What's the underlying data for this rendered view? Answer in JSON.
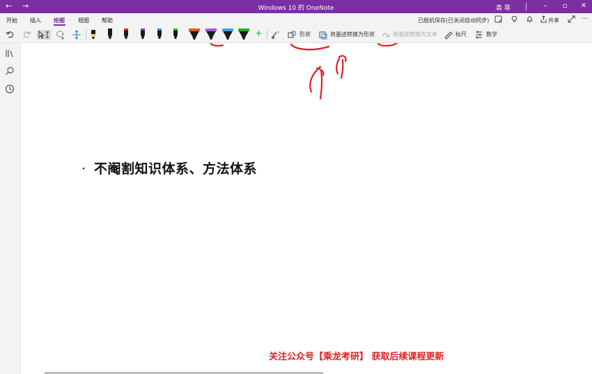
{
  "titlebar": {
    "back": "←",
    "forward": "→",
    "title": "Windows 10 的 OneNote",
    "user": "袁 菲",
    "minimize": "–",
    "maximize": "▫",
    "close": "✕"
  },
  "menu": {
    "tabs": [
      "开始",
      "插入",
      "绘图",
      "视图",
      "帮助"
    ],
    "active_tab": "绘图",
    "save_status": "已脱机保存(已关闭自动同步)",
    "share": "共享",
    "more": "···"
  },
  "toolbar": {
    "shapes": "形状",
    "ink_to_shape": "将墨迹转换为形状",
    "ink_to_text": "将墨迹转换为文本",
    "ruler": "标尺",
    "math": "数学",
    "add_pen": "+",
    "pens": [
      {
        "color": "#f2d046"
      },
      {
        "color": "#1a1a1a"
      },
      {
        "color": "#d62828"
      },
      {
        "color": "#7b3fa8"
      },
      {
        "color": "#2a8fd8"
      },
      {
        "color": "#2e9e3a"
      },
      {
        "color": "#e85a16"
      },
      {
        "color": "#a45be0"
      },
      {
        "color": "#3aa6e6"
      },
      {
        "color": "#22b022"
      }
    ]
  },
  "page": {
    "bullet": "·",
    "text": "不阉割知识体系、方法体系",
    "promo": "关注公众号【乘龙考研】 获取后续课程更新"
  },
  "colors": {
    "accent": "#7b2fa2",
    "ink": "#e02020",
    "promo": "#e02020"
  }
}
